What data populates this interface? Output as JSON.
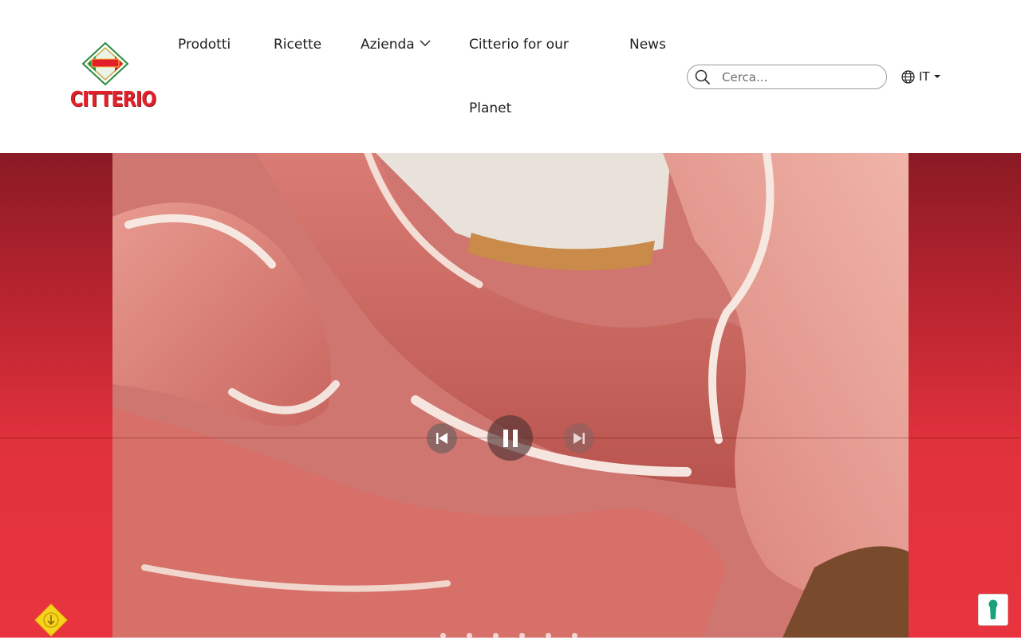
{
  "brand": {
    "name": "CITTERIO",
    "logo_color": "#e3202a"
  },
  "nav": {
    "items": [
      {
        "label": "Prodotti"
      },
      {
        "label": "Ricette"
      },
      {
        "label": "Azienda",
        "has_dropdown": true
      },
      {
        "label": "Citterio for our",
        "label_line2": "Planet"
      },
      {
        "label": "News"
      }
    ]
  },
  "search": {
    "placeholder": "Cerca...",
    "value": ""
  },
  "language": {
    "label": "IT",
    "icon": "globe-icon"
  },
  "hero": {
    "background_top": "#8a1a24",
    "background_bottom": "#e8343f",
    "video": {
      "subject": "prosciutto slices",
      "playing": true
    },
    "controls": [
      "previous-icon",
      "pause-icon",
      "next-icon"
    ],
    "slide_count": 6,
    "active_slide": 1
  },
  "floating": {
    "scroll_button_color": "#f7d21e",
    "accessibility_icon_color": "#1aa37a"
  }
}
